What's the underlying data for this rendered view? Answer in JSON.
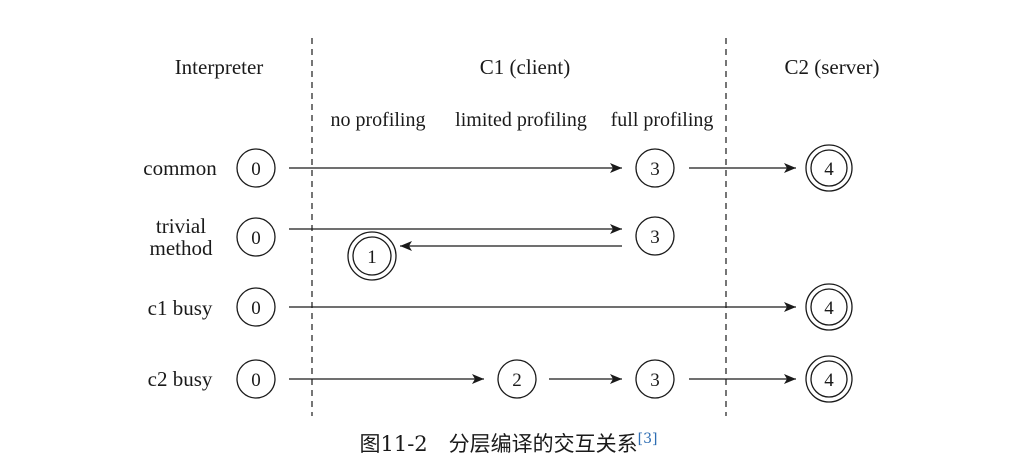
{
  "diagram": {
    "headers": {
      "interpreter": "Interpreter",
      "c1": "C1 (client)",
      "c2": "C2 (server)"
    },
    "subheaders": {
      "no_profiling": "no profiling",
      "limited_profiling": "limited profiling",
      "full_profiling": "full profiling"
    },
    "rows": {
      "common": {
        "label": "common",
        "s0": "0",
        "s3": "3",
        "s4": "4"
      },
      "trivial": {
        "label_line1": "trivial",
        "label_line2": "method",
        "s0": "0",
        "s3": "3",
        "s1": "1"
      },
      "c1busy": {
        "label": "c1 busy",
        "s0": "0",
        "s4": "4"
      },
      "c2busy": {
        "label": "c2 busy",
        "s0": "0",
        "s2": "2",
        "s3": "3",
        "s4": "4"
      }
    }
  },
  "caption": {
    "text": "图11-2　分层编译的交互关系",
    "ref": "[3]"
  }
}
